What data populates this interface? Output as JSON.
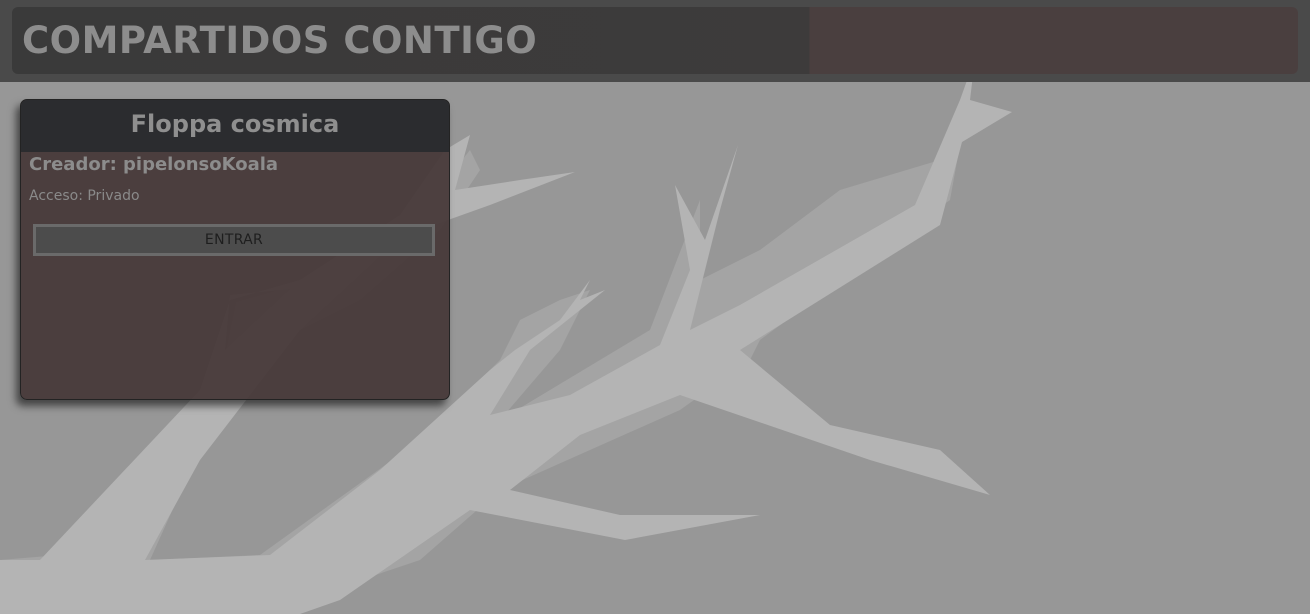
{
  "header": {
    "title": "COMPARTIDOS CONTIGO"
  },
  "shared_items": [
    {
      "name": "Floppa cosmica",
      "creator_text": "Creador: pipelonsoKoala",
      "access_text": "Acceso: Privado",
      "enter_label": "ENTRAR"
    }
  ],
  "colors": {
    "background": "#979797",
    "branch": "#b2b2b2",
    "card_background": "#443636",
    "card_header": "#2b2c2f",
    "topbar": "#3a3a3a"
  }
}
